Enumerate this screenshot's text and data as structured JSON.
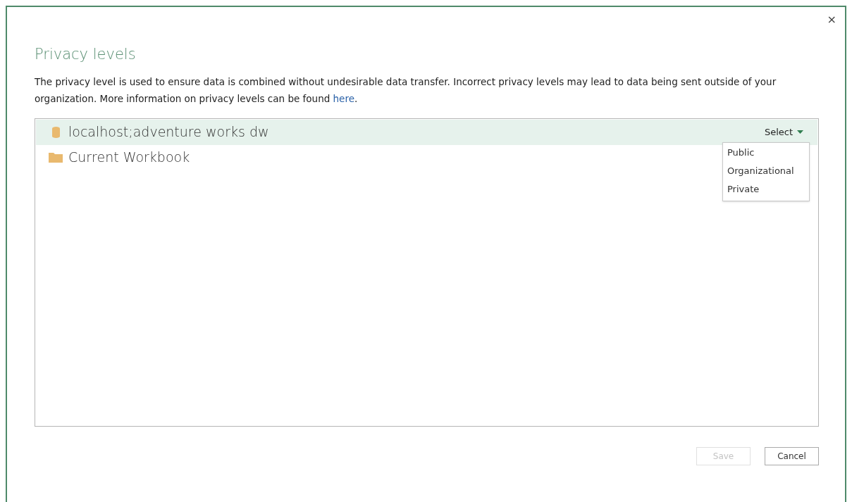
{
  "dialog": {
    "close": "×",
    "title": "Privacy levels",
    "description": {
      "text": "The privacy level is used to ensure data is combined without undesirable data transfer. Incorrect privacy levels may lead to data being sent outside of your organization. More information on privacy levels can be found ",
      "link": "here",
      "after": "."
    }
  },
  "sources": [
    {
      "kind": "database",
      "name": "localhost;adventure works dw",
      "selected": true,
      "select_label": "Select"
    },
    {
      "kind": "folder",
      "name": "Current Workbook",
      "selected": false
    }
  ],
  "privacy_menu": {
    "options": [
      "Public",
      "Organizational",
      "Private"
    ]
  },
  "buttons": [
    {
      "label": "Save",
      "disabled": true
    },
    {
      "label": "Cancel",
      "disabled": false
    }
  ]
}
